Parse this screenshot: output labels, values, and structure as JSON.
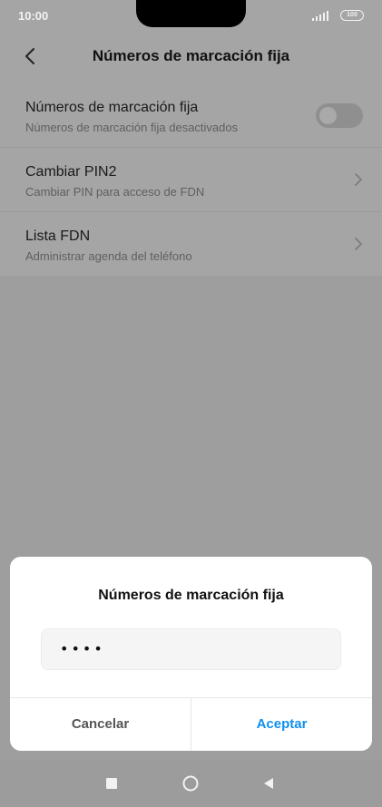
{
  "status_bar": {
    "time": "10:00",
    "battery": "100"
  },
  "header": {
    "title": "Números de marcación fija"
  },
  "list": [
    {
      "title": "Números de marcación fija",
      "subtitle": "Números de marcación fija desactivados",
      "toggle_on": false
    },
    {
      "title": "Cambiar PIN2",
      "subtitle": "Cambiar PIN para acceso de FDN"
    },
    {
      "title": "Lista FDN",
      "subtitle": "Administrar agenda del teléfono"
    }
  ],
  "dialog": {
    "title": "Números de marcación fija",
    "pin_value": "••••",
    "cancel_label": "Cancelar",
    "accept_label": "Aceptar"
  },
  "colors": {
    "accent": "#0f8ff0",
    "overlay": "#9e9e9e"
  },
  "icons": {
    "back": "chevron-left-icon",
    "row_arrow": "chevron-right-icon",
    "nav_recent": "square-icon",
    "nav_home": "circle-icon",
    "nav_back": "triangle-back-icon"
  }
}
